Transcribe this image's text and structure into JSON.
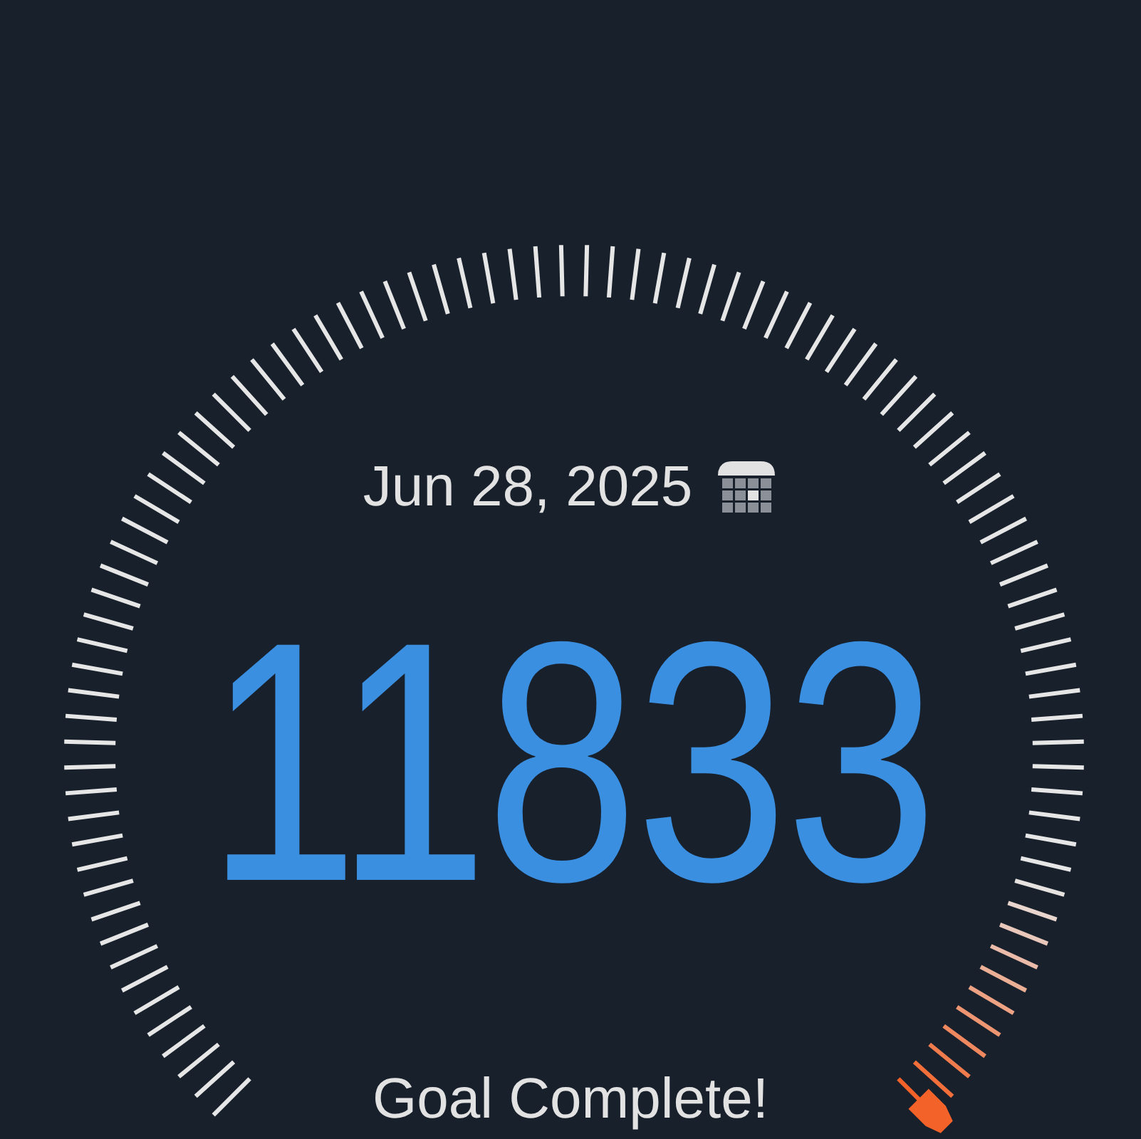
{
  "date": "Jun 28, 2025",
  "steps": "11833",
  "status": "Goal Complete!"
}
